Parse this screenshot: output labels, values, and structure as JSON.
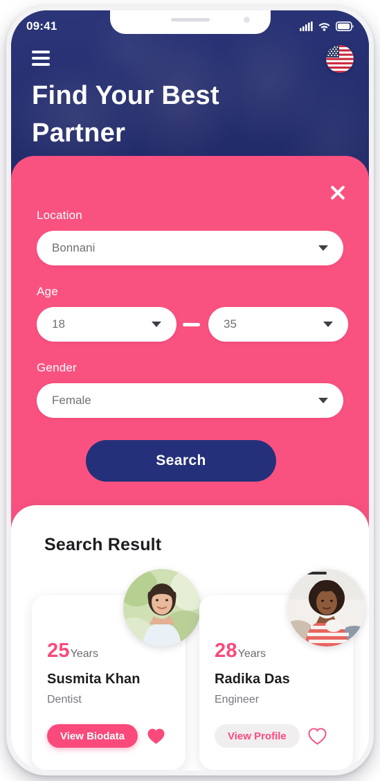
{
  "status_bar": {
    "time": "09:41",
    "icons": [
      "cellular-signal-icon",
      "wifi-icon",
      "battery-icon"
    ]
  },
  "header": {
    "menu_icon": "hamburger-menu-icon",
    "flag_icon": "us-flag-icon",
    "title_line1": "Find Your Best",
    "title_line2": "Partner"
  },
  "filter": {
    "close_icon": "close-icon",
    "location": {
      "label": "Location",
      "value": "Bonnani"
    },
    "age": {
      "label": "Age",
      "min": "18",
      "max": "35",
      "separator": "–"
    },
    "gender": {
      "label": "Gender",
      "value": "Female"
    },
    "search_button": "Search"
  },
  "results": {
    "title": "Search Result",
    "cards": [
      {
        "age": "25",
        "age_unit": "Years",
        "name": "Susmita Khan",
        "job": "Dentist",
        "action_label": "View Biodata",
        "action_style": "primary",
        "favorite": true,
        "avatar_name": "avatar-susmita-khan"
      },
      {
        "age": "28",
        "age_unit": "Years",
        "name": "Radika Das",
        "job": "Engineer",
        "action_label": "View Profile",
        "action_style": "ghost",
        "favorite": false,
        "avatar_name": "avatar-radika-das"
      }
    ]
  },
  "colors": {
    "pink": "#FA5280",
    "pink_accent": "#FA4A7B",
    "navy": "#25307A",
    "hero_blue": "#2B3576",
    "white": "#FFFFFF",
    "text_dark": "#1D1D20",
    "text_muted": "#77777D"
  }
}
